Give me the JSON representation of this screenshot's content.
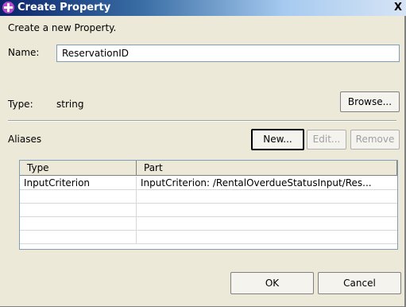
{
  "window": {
    "title": "Create Property",
    "close_label": "X"
  },
  "intro": "Create a new Property.",
  "name": {
    "label": "Name:",
    "value": "ReservationID"
  },
  "type": {
    "label": "Type:",
    "value": "string",
    "browse_label": "Browse..."
  },
  "aliases": {
    "label": "Aliases",
    "new_label": "New...",
    "edit_label": "Edit...",
    "remove_label": "Remove",
    "columns": [
      "Type",
      "Part"
    ],
    "rows": [
      {
        "type": "InputCriterion",
        "part": "InputCriterion: /RentalOverdueStatusInput/Res..."
      },
      {
        "type": "",
        "part": ""
      },
      {
        "type": "",
        "part": ""
      },
      {
        "type": "",
        "part": ""
      },
      {
        "type": "",
        "part": ""
      }
    ]
  },
  "footer": {
    "ok_label": "OK",
    "cancel_label": "Cancel"
  }
}
